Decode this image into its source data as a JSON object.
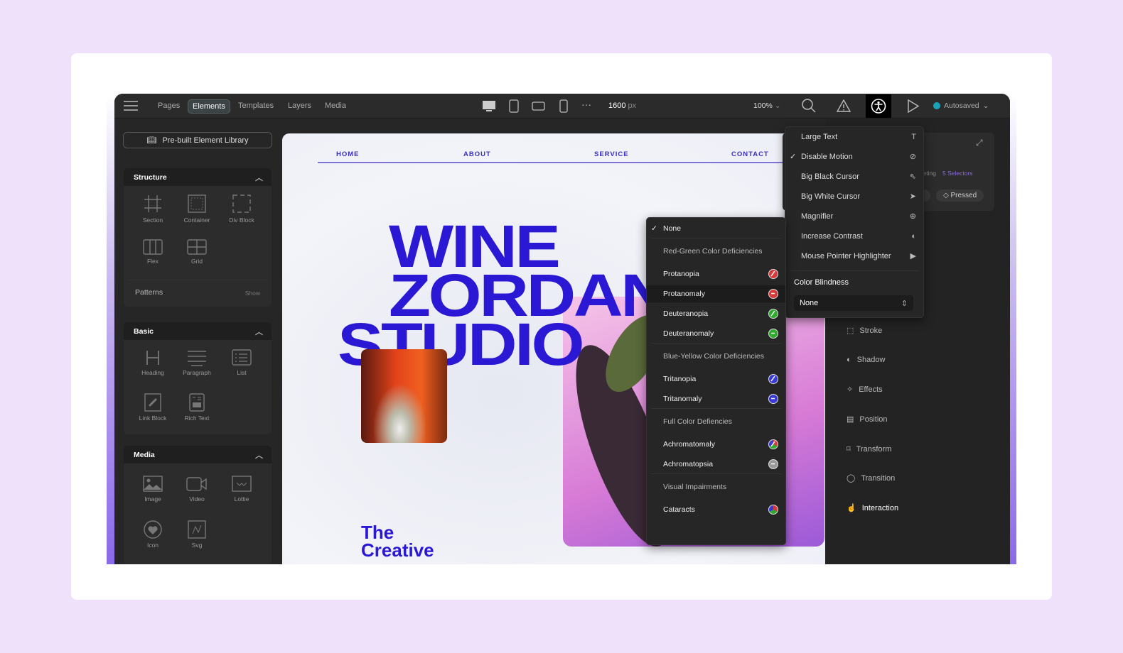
{
  "topbar": {
    "tabs": [
      "Pages",
      "Elements",
      "Templates",
      "Layers",
      "Media"
    ],
    "active_tab": "Elements",
    "width_value": "1600",
    "width_unit": "px",
    "zoom": "100%",
    "status": "Autosaved",
    "status_color": "#1aa3b8"
  },
  "left": {
    "library_button": "Pre-built Element Library",
    "structure": {
      "title": "Structure",
      "items": [
        "Section",
        "Container",
        "Div Block",
        "Flex",
        "Grid"
      ],
      "patterns": "Patterns",
      "show": "Show"
    },
    "basic": {
      "title": "Basic",
      "items": [
        "Heading",
        "Paragraph",
        "List",
        "Link Block",
        "Rich Text"
      ]
    },
    "media": {
      "title": "Media",
      "items": [
        "Image",
        "Video",
        "Lottie",
        "Icon",
        "Svg"
      ]
    }
  },
  "canvas": {
    "nav": [
      "HOME",
      "ABOUT",
      "SERVICE",
      "CONTACT"
    ],
    "hero": [
      "WINE",
      "ZORDAN",
      "STUDIO"
    ],
    "subhead": [
      "The",
      "Creative"
    ],
    "brand_color": "#2b18d4"
  },
  "right": {
    "selector_text": "ereting",
    "selectors": "5 Selectors",
    "chips": [
      "rk",
      "Pressed"
    ],
    "items": [
      "Stroke",
      "Shadow",
      "Effects",
      "Position",
      "Transform",
      "Transition",
      "Interaction"
    ]
  },
  "accessibility_menu": {
    "items": [
      {
        "label": "Large Text",
        "icon": "text-icon",
        "checked": false
      },
      {
        "label": "Disable Motion",
        "icon": "motion-off-icon",
        "checked": true
      },
      {
        "label": "Big Black Cursor",
        "icon": "cursor-outline-icon",
        "checked": false
      },
      {
        "label": "Big White Cursor",
        "icon": "cursor-icon",
        "checked": false
      },
      {
        "label": "Magnifier",
        "icon": "zoom-in-icon",
        "checked": false
      },
      {
        "label": "Increase Contrast",
        "icon": "contrast-icon",
        "checked": false
      },
      {
        "label": "Mouse Pointer Highlighter",
        "icon": "pointer-highlight-icon",
        "checked": false
      }
    ],
    "color_blindness_label": "Color Blindness",
    "color_blindness_value": "None"
  },
  "color_blindness_menu": {
    "items": [
      {
        "label": "None",
        "type": "option",
        "checked": true
      },
      {
        "label": "Red-Green Color Deficiencies",
        "type": "header"
      },
      {
        "label": "Protanopia",
        "type": "option",
        "color": "#d63a3a",
        "mark": "slash"
      },
      {
        "label": "Protanomaly",
        "type": "option",
        "color": "#d63a3a",
        "mark": "minus",
        "highlighted": true
      },
      {
        "label": "Deuteranopia",
        "type": "option",
        "color": "#2faa2f",
        "mark": "slash"
      },
      {
        "label": "Deuteranomaly",
        "type": "option",
        "color": "#2faa2f",
        "mark": "minus"
      },
      {
        "label": "Blue-Yellow Color Deficiencies",
        "type": "header"
      },
      {
        "label": "Tritanopia",
        "type": "option",
        "color": "#3a3ad6",
        "mark": "slash"
      },
      {
        "label": "Tritanomaly",
        "type": "option",
        "color": "#3a3ad6",
        "mark": "minus"
      },
      {
        "label": "Full Color Defiencies",
        "type": "header"
      },
      {
        "label": "Achromatomaly",
        "type": "option",
        "color": "multi",
        "mark": "slash"
      },
      {
        "label": "Achromatopsia",
        "type": "option",
        "color": "#999999",
        "mark": "minus"
      },
      {
        "label": "Visual Impairments",
        "type": "header"
      },
      {
        "label": "Cataracts",
        "type": "option",
        "color": "multi",
        "mark": "none"
      }
    ]
  }
}
